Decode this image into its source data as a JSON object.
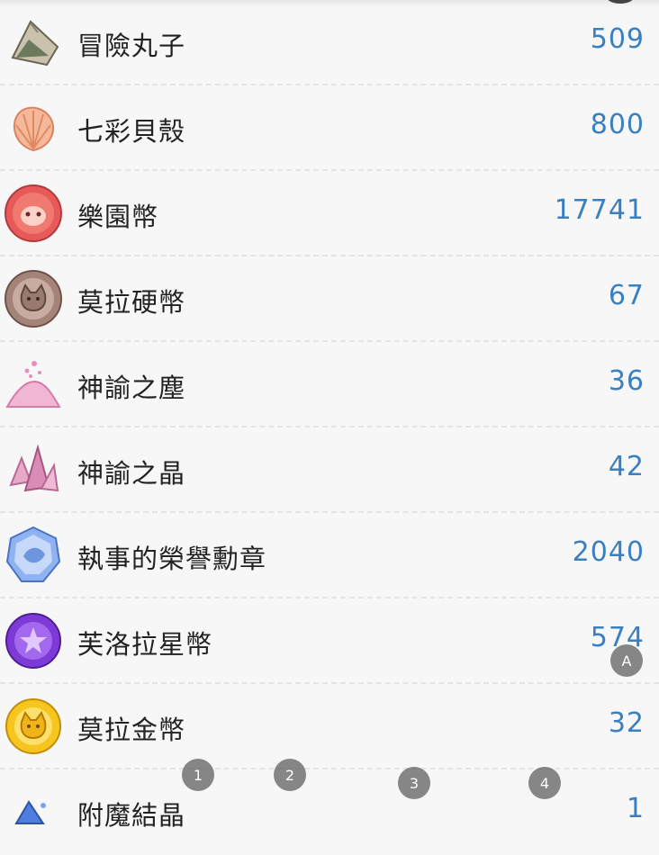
{
  "items": [
    {
      "label": "冒險丸子",
      "count": "509",
      "icon": "rice-ball-icon"
    },
    {
      "label": "七彩貝殼",
      "count": "800",
      "icon": "seashell-icon"
    },
    {
      "label": "樂園幣",
      "count": "17741",
      "icon": "paradise-coin-icon"
    },
    {
      "label": "莫拉硬幣",
      "count": "67",
      "icon": "mora-coin-icon"
    },
    {
      "label": "神諭之塵",
      "count": "36",
      "icon": "oracle-dust-icon"
    },
    {
      "label": "神諭之晶",
      "count": "42",
      "icon": "oracle-crystal-icon"
    },
    {
      "label": "執事的榮譽勳章",
      "count": "2040",
      "icon": "butler-medal-icon"
    },
    {
      "label": "芙洛拉星幣",
      "count": "574",
      "icon": "flora-star-coin-icon"
    },
    {
      "label": "莫拉金幣",
      "count": "32",
      "icon": "mora-gold-coin-icon"
    },
    {
      "label": "附魔結晶",
      "count": "1",
      "icon": "enchant-crystal-icon"
    }
  ],
  "overlay_buttons": {
    "a": "A",
    "b1": "1",
    "b2": "2",
    "b3": "3",
    "b4": "4"
  },
  "colors": {
    "count": "#3a7fc0",
    "text": "#222222",
    "background": "#f7f7f7"
  }
}
